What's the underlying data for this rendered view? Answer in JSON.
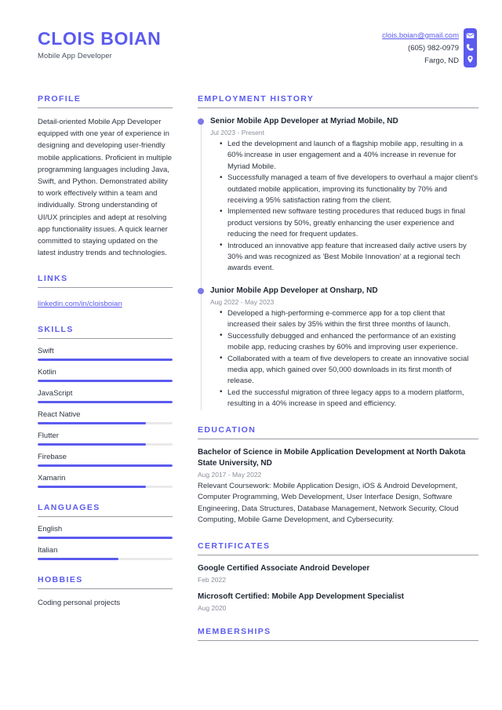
{
  "header": {
    "name": "CLOIS BOIAN",
    "job_title": "Mobile App Developer",
    "email": "clois.boian@gmail.com",
    "phone": "(605) 982-0979",
    "location": "Fargo, ND",
    "icons": [
      "envelope-icon",
      "phone-icon",
      "location-pin-icon"
    ]
  },
  "colors": {
    "accent": "#5b5bef",
    "dot": "#7b78e8",
    "text": "#2d3440",
    "muted": "#8a8f99",
    "rule": "#9a9aa3",
    "track": "#e9e9ec"
  },
  "left": {
    "profile": {
      "title": "Profile",
      "text": "Detail-oriented Mobile App Developer equipped with one year of experience in designing and developing user-friendly mobile applications. Proficient in multiple programming languages including Java, Swift, and Python. Demonstrated ability to work effectively within a team and individually. Strong understanding of UI/UX principles and adept at resolving app functionality issues. A quick learner committed to staying updated on the latest industry trends and technologies."
    },
    "links": {
      "title": "Links",
      "items": [
        {
          "label": "linkedin.com/in/cloisboian"
        }
      ]
    },
    "skills": {
      "title": "Skills",
      "items": [
        {
          "label": "Swift",
          "level": 100
        },
        {
          "label": "Kotlin",
          "level": 100
        },
        {
          "label": "JavaScript",
          "level": 100
        },
        {
          "label": "React Native",
          "level": 80
        },
        {
          "label": "Flutter",
          "level": 80
        },
        {
          "label": "Firebase",
          "level": 100
        },
        {
          "label": "Xamarin",
          "level": 80
        }
      ]
    },
    "languages": {
      "title": "Languages",
      "items": [
        {
          "label": "English",
          "level": 100
        },
        {
          "label": "Italian",
          "level": 60
        }
      ]
    },
    "hobbies": {
      "title": "Hobbies",
      "items": [
        {
          "label": "Coding personal projects"
        }
      ]
    }
  },
  "right": {
    "employment": {
      "title": "Employment History",
      "jobs": [
        {
          "title": "Senior Mobile App Developer at Myriad Mobile, ND",
          "date": "Jul 2023 - Present",
          "bullets": [
            "Led the development and launch of a flagship mobile app, resulting in a 60% increase in user engagement and a 40% increase in revenue for Myriad Mobile.",
            "Successfully managed a team of five developers to overhaul a major client's outdated mobile application, improving its functionality by 70% and receiving a 95% satisfaction rating from the client.",
            "Implemented new software testing procedures that reduced bugs in final product versions by 50%, greatly enhancing the user experience and reducing the need for frequent updates.",
            "Introduced an innovative app feature that increased daily active users by 30% and was recognized as 'Best Mobile Innovation' at a regional tech awards event."
          ]
        },
        {
          "title": "Junior Mobile App Developer at Onsharp, ND",
          "date": "Aug 2022 - May 2023",
          "bullets": [
            "Developed a high-performing e-commerce app for a top client that increased their sales by 35% within the first three months of launch.",
            "Successfully debugged and enhanced the performance of an existing mobile app, reducing crashes by 60% and improving user experience.",
            "Collaborated with a team of five developers to create an innovative social media app, which gained over 50,000 downloads in its first month of release.",
            "Led the successful migration of three legacy apps to a modern platform, resulting in a 40% increase in speed and efficiency."
          ]
        }
      ]
    },
    "education": {
      "title": "Education",
      "entries": [
        {
          "title": "Bachelor of Science in Mobile Application Development at North Dakota State University, ND",
          "date": "Aug 2017 - May 2022",
          "description": "Relevant Coursework: Mobile Application Design, iOS & Android Development, Computer Programming, Web Development, User Interface Design, Software Engineering, Data Structures, Database Management, Network Security, Cloud Computing, Mobile Game Development, and Cybersecurity."
        }
      ]
    },
    "certificates": {
      "title": "Certificates",
      "entries": [
        {
          "title": "Google Certified Associate Android Developer",
          "date": "Feb 2022"
        },
        {
          "title": "Microsoft Certified: Mobile App Development Specialist",
          "date": "Aug 2020"
        }
      ]
    },
    "memberships": {
      "title": "Memberships"
    }
  }
}
